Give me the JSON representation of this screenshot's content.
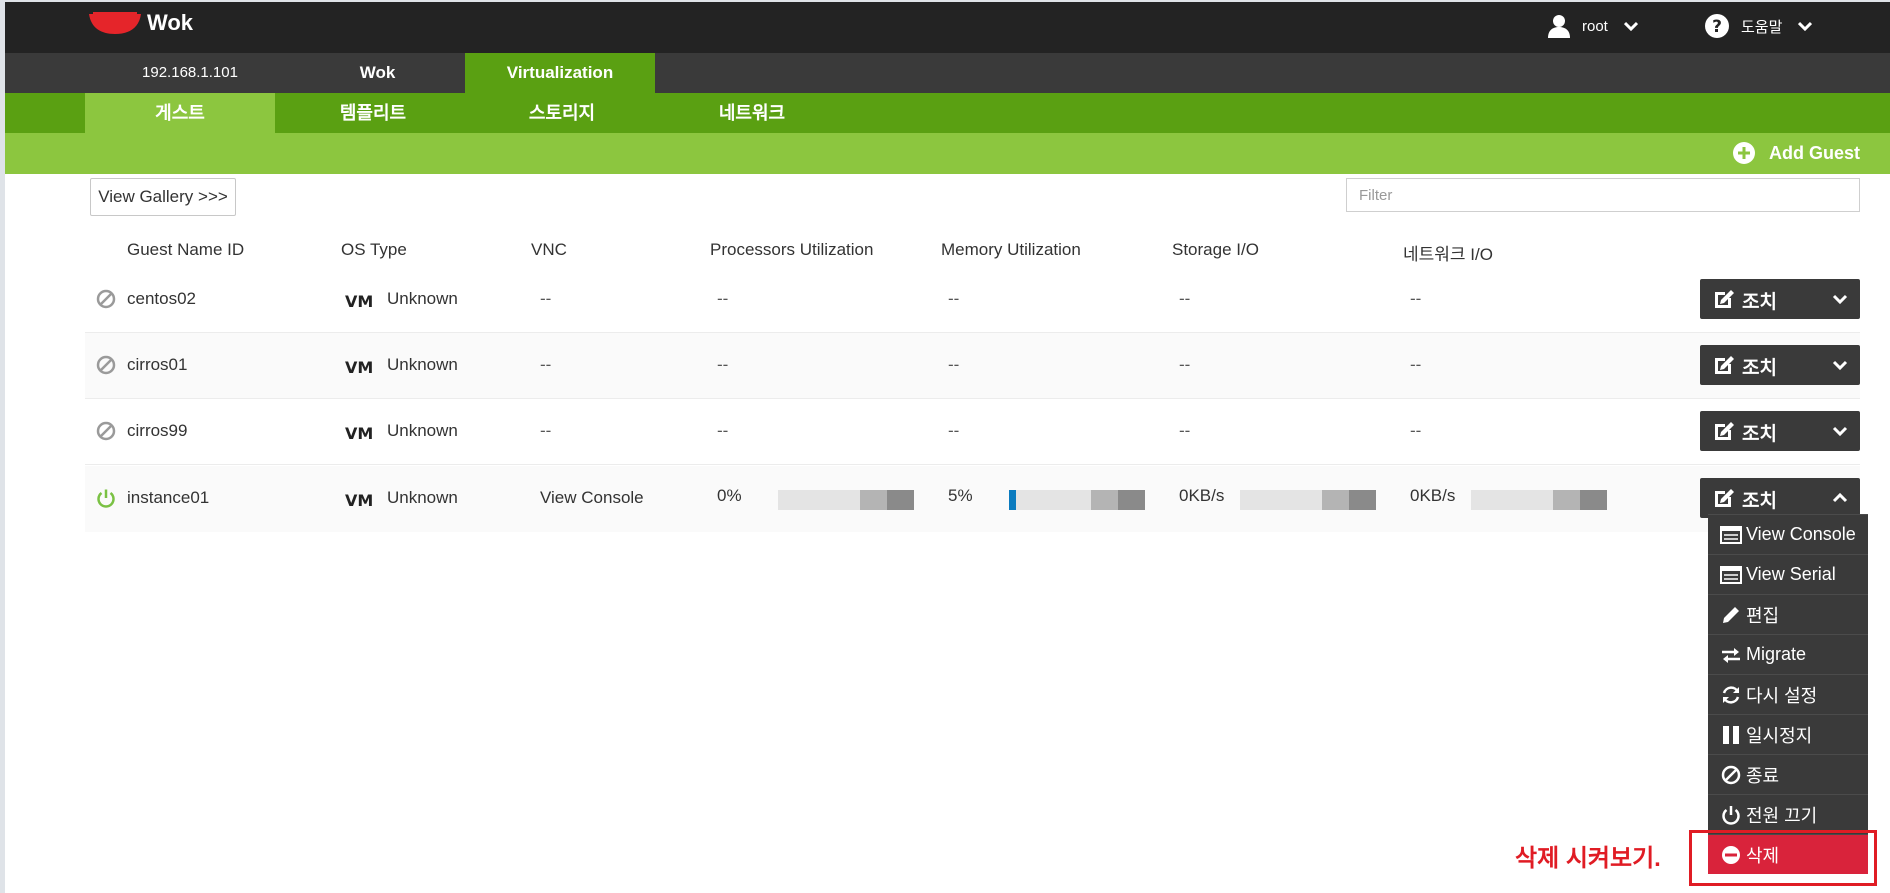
{
  "topbar": {
    "app_name": "Wok",
    "user": "root",
    "help": "도움말"
  },
  "host_tabs": {
    "ip": "192.168.1.101",
    "wok": "Wok",
    "virtualization": "Virtualization"
  },
  "sub_tabs": [
    "게스트",
    "템플리트",
    "스토리지",
    "네트워크"
  ],
  "actionbar": {
    "add_guest": "Add Guest"
  },
  "gallery_button": "View Gallery >>>",
  "filter_placeholder": "Filter",
  "columns": [
    "Guest Name ID",
    "OS Type",
    "VNC",
    "Processors Utilization",
    "Memory Utilization",
    "Storage I/O",
    "네트워크 I/O"
  ],
  "guests": [
    {
      "name": "centos02",
      "status": "stopped",
      "os": "Unknown",
      "vnc": "--",
      "cpu": "--",
      "memory": "--",
      "storage": "--",
      "network": "--"
    },
    {
      "name": "cirros01",
      "status": "stopped",
      "os": "Unknown",
      "vnc": "--",
      "cpu": "--",
      "memory": "--",
      "storage": "--",
      "network": "--"
    },
    {
      "name": "cirros99",
      "status": "stopped",
      "os": "Unknown",
      "vnc": "--",
      "cpu": "--",
      "memory": "--",
      "storage": "--",
      "network": "--"
    },
    {
      "name": "instance01",
      "status": "running",
      "os": "Unknown",
      "vnc": "View Console",
      "cpu": "0%",
      "cpu_fraction": 0.0,
      "memory": "5%",
      "memory_fraction": 0.05,
      "storage": "0KB/s",
      "network": "0KB/s"
    }
  ],
  "action_label": "조치",
  "action_menu": [
    {
      "label": "View Console",
      "icon": "console-icon"
    },
    {
      "label": "View Serial",
      "icon": "serial-icon"
    },
    {
      "label": "편집",
      "icon": "pencil-icon"
    },
    {
      "label": "Migrate",
      "icon": "migrate-icon"
    },
    {
      "label": "다시 설정",
      "icon": "refresh-icon"
    },
    {
      "label": "일시정지",
      "icon": "pause-icon"
    },
    {
      "label": "종료",
      "icon": "ban-icon"
    },
    {
      "label": "전원 끄기",
      "icon": "power-icon"
    },
    {
      "label": "삭제",
      "icon": "minus-circle-icon"
    }
  ],
  "annotation": "삭제 시켜보기.",
  "colors": {
    "topbar": "#232323",
    "green": "#5aa012",
    "light_green": "#8cc63f",
    "danger": "#d9233b",
    "annotation": "#e01c24"
  }
}
